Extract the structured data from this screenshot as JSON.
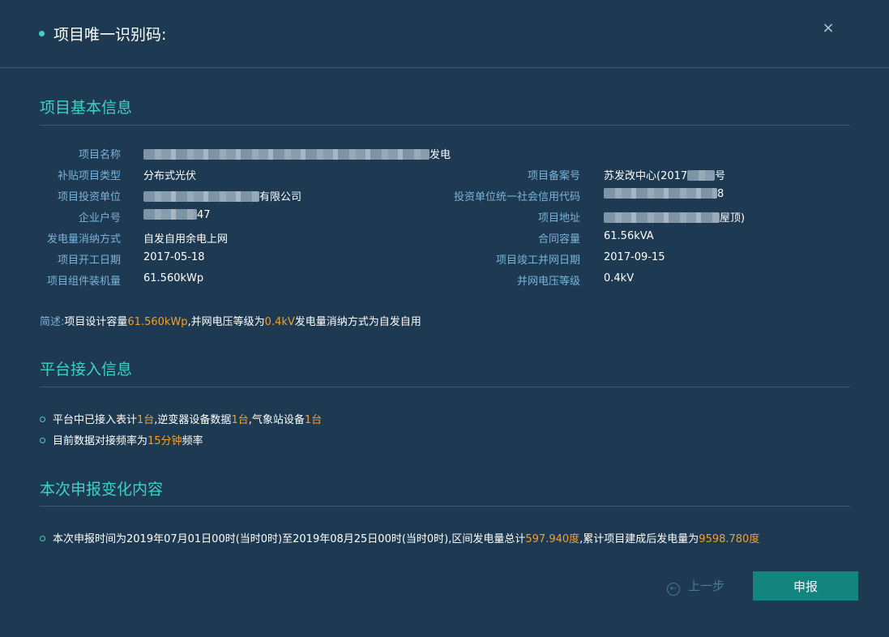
{
  "header": {
    "title": "项目唯一识别码:",
    "close_icon": "×"
  },
  "basic": {
    "section_title": "项目基本信息",
    "fields": [
      {
        "label": "项目名称",
        "value": "发电"
      },
      {
        "label": "补贴项目类型",
        "value": "分布式光伏"
      },
      {
        "label": "项目备案号",
        "value_prefix": "苏发改中心(2017",
        "value_suffix": "号"
      },
      {
        "label": "项目投资单位",
        "value": "有限公司"
      },
      {
        "label": "投资单位统一社会信用代码",
        "value": "8"
      },
      {
        "label": "企业户号",
        "value": "47"
      },
      {
        "label": "项目地址",
        "value": "屋顶)"
      },
      {
        "label": "发电量消纳方式",
        "value": "自发自用余电上网"
      },
      {
        "label": "合同容量",
        "value": "61.56kVA"
      },
      {
        "label": "项目开工日期",
        "value": "2017-05-18"
      },
      {
        "label": "项目竣工并网日期",
        "value": "2017-09-15"
      },
      {
        "label": "项目组件装机量",
        "value": "61.560kWp"
      },
      {
        "label": "并网电压等级",
        "value": "0.4kV"
      }
    ],
    "description": {
      "prefix": "简述:",
      "part1": "项目设计容量",
      "capacity": "61.560kWp",
      "part2": ",并网电压等级为",
      "voltage": "0.4kV",
      "part3": "发电量消纳方式为自发自用"
    }
  },
  "platform": {
    "section_title": "平台接入信息",
    "line1": {
      "t1": "平台中已接入表计",
      "v1": "1台",
      "t2": ",逆变器设备数据",
      "v2": "1台",
      "t3": ",气象站设备",
      "v3": "1台"
    },
    "line2": {
      "t1": "目前数据对接频率为",
      "v1": "15分钟",
      "t2": "频率"
    }
  },
  "change": {
    "section_title": "本次申报变化内容",
    "line": {
      "t1": "本次申报时间为2019年07月01日00时(当时0时)至2019年08月25日00时(当时0时),区间发电量总计",
      "v1": "597.940度",
      "t2": ",累计项目建成后发电量为",
      "v2": "9598.780度"
    }
  },
  "footer": {
    "prev_label": "上一步",
    "prev_icon": "←",
    "submit_label": "申报"
  },
  "colors": {
    "background": "#1d3a52",
    "accent": "#3fd0c4",
    "label": "#7ab3d8",
    "highlight": "#f0a030",
    "button": "#13857e"
  }
}
